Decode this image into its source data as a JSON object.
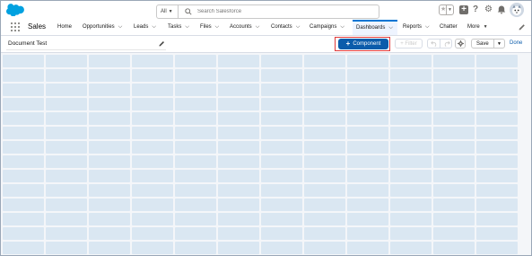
{
  "header": {
    "app_logo": "salesforce-cloud-logo",
    "search": {
      "scope_label": "All",
      "placeholder": "Search Salesforce"
    },
    "icons": [
      "star-icon",
      "add-icon",
      "help-icon",
      "setup-icon",
      "bell-icon",
      "avatar"
    ]
  },
  "nav": {
    "app_name": "Sales",
    "items": [
      {
        "label": "Home",
        "has_dropdown": false
      },
      {
        "label": "Opportunities",
        "has_dropdown": true
      },
      {
        "label": "Leads",
        "has_dropdown": true
      },
      {
        "label": "Tasks",
        "has_dropdown": true
      },
      {
        "label": "Files",
        "has_dropdown": true
      },
      {
        "label": "Accounts",
        "has_dropdown": true
      },
      {
        "label": "Contacts",
        "has_dropdown": true
      },
      {
        "label": "Campaigns",
        "has_dropdown": true
      },
      {
        "label": "Dashboards",
        "has_dropdown": true,
        "active": true
      },
      {
        "label": "Reports",
        "has_dropdown": true
      },
      {
        "label": "Chatter",
        "has_dropdown": false
      },
      {
        "label": "More",
        "has_dropdown": true
      }
    ]
  },
  "toolbar": {
    "dashboard_title": "Document Test",
    "component_button": "Component",
    "filter_button": "+ Filter",
    "save_button": "Save",
    "done_link": "Done"
  },
  "canvas": {
    "columns": 12,
    "rows": 14
  },
  "colors": {
    "brand_blue": "#0176d3",
    "component_button": "#0b5cab",
    "highlight": "#e03a3a",
    "grid_cell": "#dae7f2",
    "canvas_bg": "#f4f6f9"
  }
}
